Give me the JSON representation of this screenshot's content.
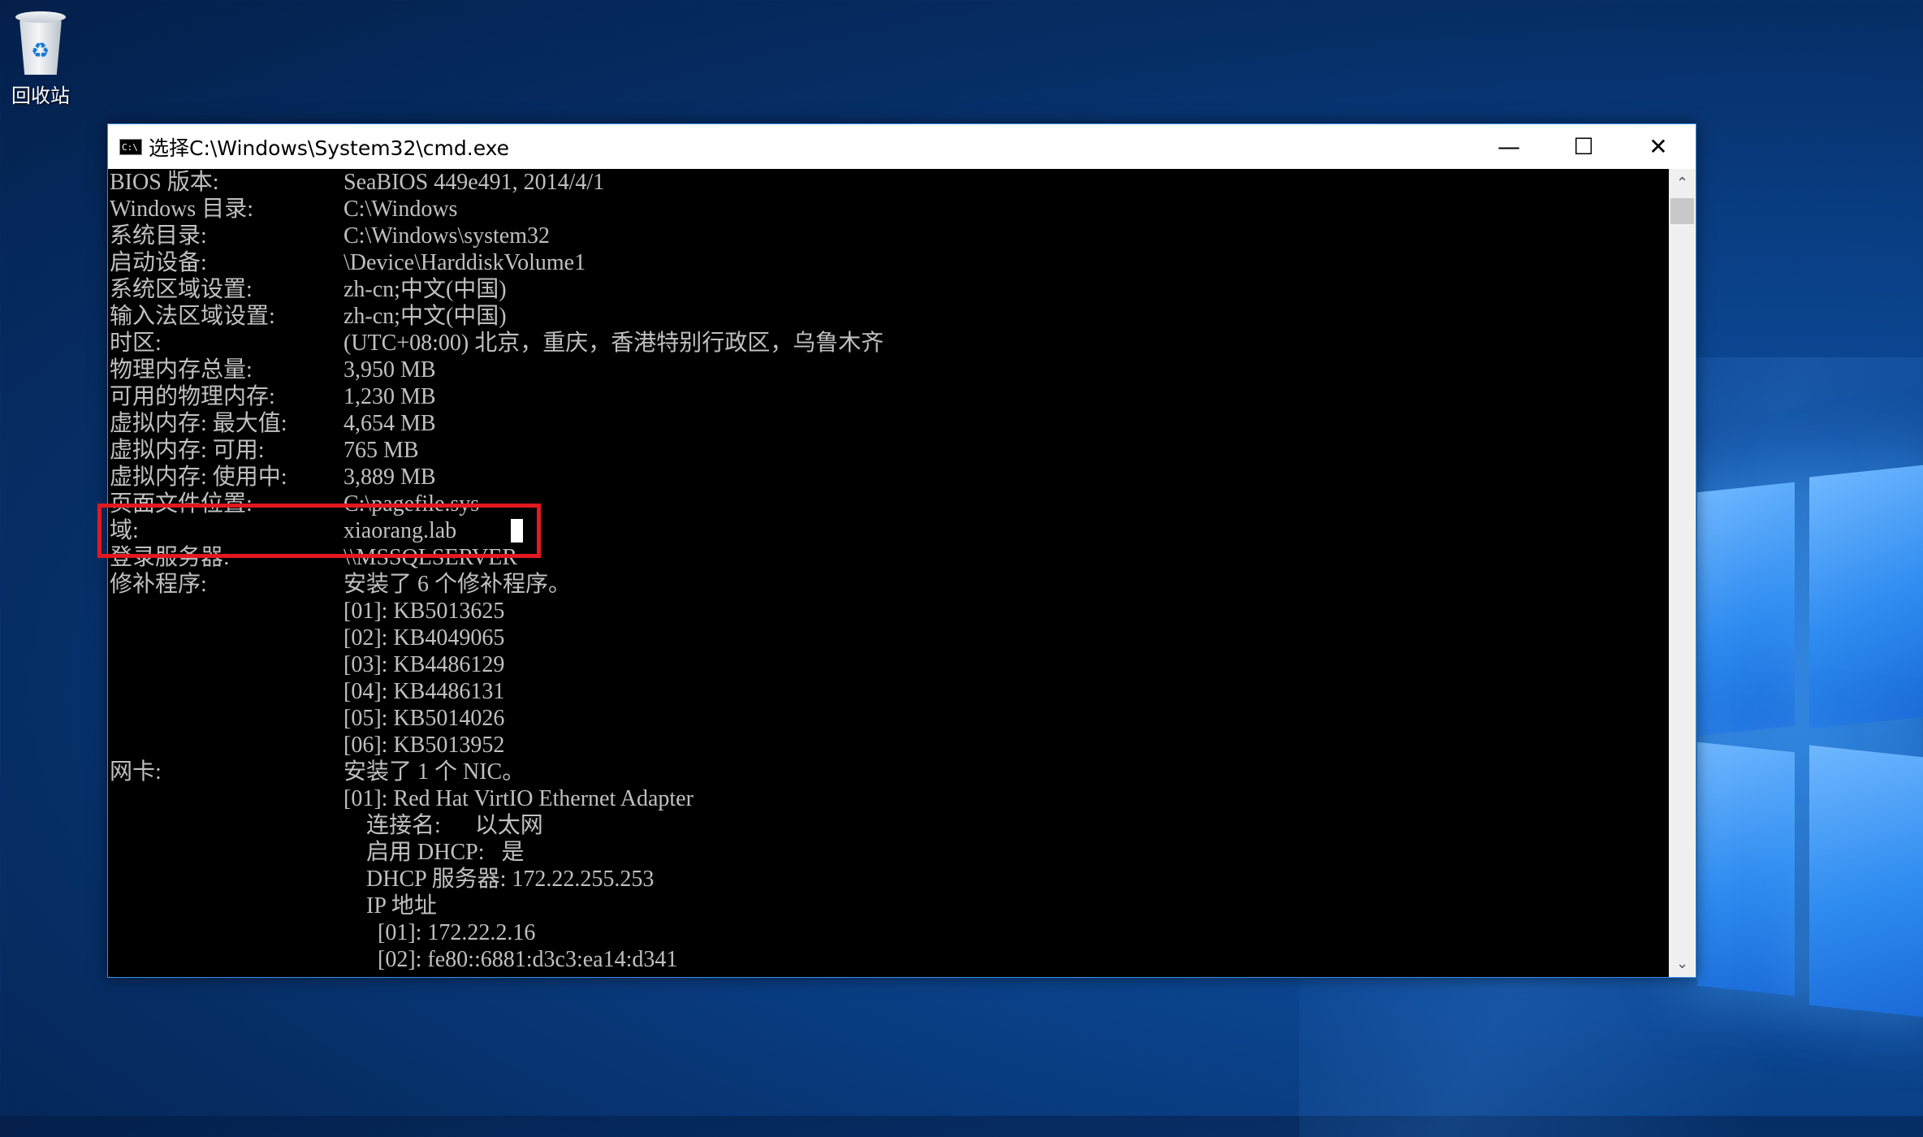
{
  "desktop": {
    "recycle_bin_label": "回收站"
  },
  "window": {
    "title": "选择C:\\Windows\\System32\\cmd.exe",
    "icon_text": "C:\\",
    "controls": {
      "minimize": "—",
      "maximize": "☐",
      "close": "✕"
    }
  },
  "console": {
    "lines": [
      {
        "label": "BIOS 版本:",
        "value": "SeaBIOS 449e491, 2014/4/1"
      },
      {
        "label": "Windows 目录:",
        "value": "C:\\Windows"
      },
      {
        "label": "系统目录:",
        "value": "C:\\Windows\\system32"
      },
      {
        "label": "启动设备:",
        "value": "\\Device\\HarddiskVolume1"
      },
      {
        "label": "系统区域设置:",
        "value": "zh-cn;中文(中国)"
      },
      {
        "label": "输入法区域设置:",
        "value": "zh-cn;中文(中国)"
      },
      {
        "label": "时区:",
        "value": "(UTC+08:00) 北京，重庆，香港特别行政区，乌鲁木齐"
      },
      {
        "label": "物理内存总量:",
        "value": "3,950 MB"
      },
      {
        "label": "可用的物理内存:",
        "value": "1,230 MB"
      },
      {
        "label": "虚拟内存: 最大值:",
        "value": "4,654 MB"
      },
      {
        "label": "虚拟内存: 可用:",
        "value": "765 MB"
      },
      {
        "label": "虚拟内存: 使用中:",
        "value": "3,889 MB"
      },
      {
        "label": "页面文件位置:",
        "value": "C:\\pagefile.sys"
      },
      {
        "label": "域:",
        "value": "xiaorang.lab"
      },
      {
        "label": "登录服务器:",
        "value": "\\\\MSSQLSERVER"
      },
      {
        "label": "修补程序:",
        "value": "安装了 6 个修补程序。"
      },
      {
        "label": "",
        "value": "[01]: KB5013625"
      },
      {
        "label": "",
        "value": "[02]: KB4049065"
      },
      {
        "label": "",
        "value": "[03]: KB4486129"
      },
      {
        "label": "",
        "value": "[04]: KB4486131"
      },
      {
        "label": "",
        "value": "[05]: KB5014026"
      },
      {
        "label": "",
        "value": "[06]: KB5013952"
      },
      {
        "label": "网卡:",
        "value": "安装了 1 个 NIC。"
      },
      {
        "label": "",
        "value": "[01]: Red Hat VirtIO Ethernet Adapter"
      },
      {
        "label": "",
        "value": "    连接名:      以太网"
      },
      {
        "label": "",
        "value": "    启用 DHCP:   是"
      },
      {
        "label": "",
        "value": "    DHCP 服务器: 172.22.255.253"
      },
      {
        "label": "",
        "value": "    IP 地址"
      },
      {
        "label": "",
        "value": "      [01]: 172.22.2.16"
      },
      {
        "label": "",
        "value": "      [02]: fe80::6881:d3c3:ea14:d341"
      }
    ]
  },
  "colors": {
    "highlight_box": "#e2191f",
    "console_text": "#c0c0c0",
    "console_bg": "#000000"
  }
}
